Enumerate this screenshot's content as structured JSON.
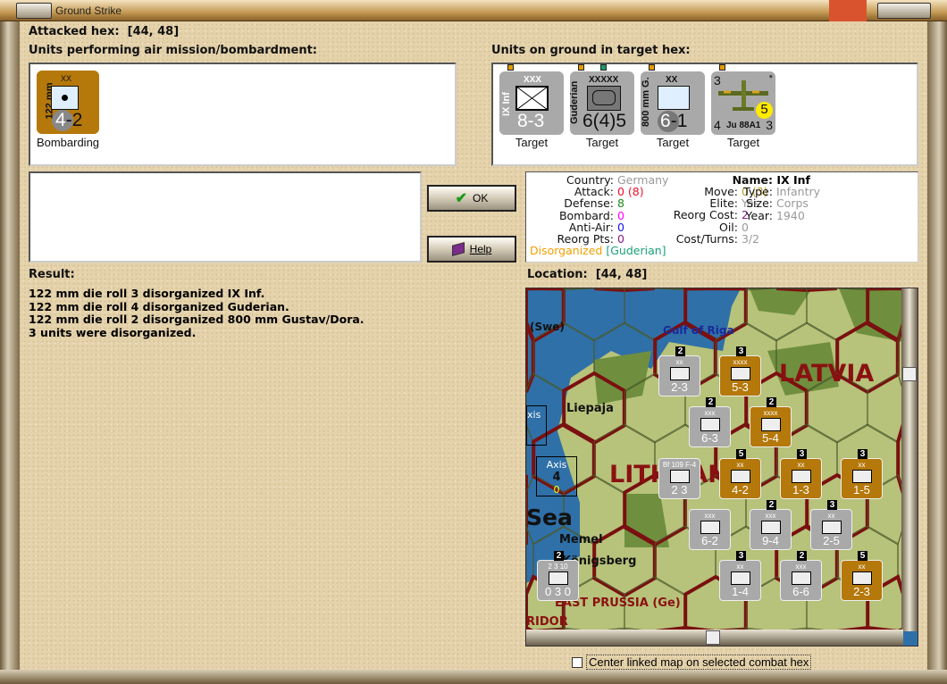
{
  "window": {
    "title": "Ground Strike"
  },
  "attacked_hex": {
    "label": "Attacked hex:",
    "value": "[44, 48]"
  },
  "air_mission": {
    "heading": "Units performing air mission/bombardment:",
    "units": [
      {
        "name": "122 mm",
        "echelon": "XX",
        "attack": "4",
        "defense": "2",
        "status": "Bombarding"
      }
    ]
  },
  "ground_units": {
    "heading": "Units on ground in target hex:",
    "units": [
      {
        "name": "IX Inf",
        "echelon": "XXX",
        "strength": "8-3",
        "status": "Target"
      },
      {
        "name": "Guderian",
        "echelon": "XXXXX",
        "strength": "6(4)5",
        "status": "Target"
      },
      {
        "name": "800 mm G.",
        "echelon": "XX",
        "attack": "6",
        "defense": "1",
        "status": "Target"
      },
      {
        "name": "Ju 88A1",
        "top_left": "3",
        "bottom_left": "4",
        "bottom_right": "3",
        "marker": "*",
        "badge": "5",
        "status": "Target"
      }
    ]
  },
  "buttons": {
    "ok": "OK",
    "help": "Help"
  },
  "unit_info": {
    "country_label": "Country:",
    "country": "Germany",
    "attack_label": "Attack:",
    "attack": "0",
    "attack_extra": "(8)",
    "defense_label": "Defense:",
    "defense": "8",
    "bombard_label": "Bombard:",
    "bombard": "0",
    "antiair_label": "Anti-Air:",
    "antiair": "0",
    "reorgpts_label": "Reorg Pts:",
    "reorgpts": "0",
    "move_label": "Move:",
    "move": "0",
    "move_extra": "(3)",
    "elite_label": "Elite:",
    "elite": "Yes",
    "reorgcost_label": "Reorg Cost:",
    "reorgcost": "2",
    "oil_label": "Oil:",
    "oil": "0",
    "costturns_label": "Cost/Turns:",
    "costturns": "3/2",
    "name_label": "Name:",
    "name": "IX Inf",
    "type_label": "Type:",
    "type": "Infantry",
    "size_label": "Size:",
    "size": "Corps",
    "year_label": "Year:",
    "year": "1940",
    "status": "Disorganized",
    "hq": "[Guderian]"
  },
  "result": {
    "heading": "Result:",
    "lines": [
      "122 mm die roll 3 disorganized IX Inf.",
      "122 mm die roll 4 disorganized Guderian.",
      "122 mm die roll 2 disorganized 800 mm Gustav/Dora.",
      "3 units were disorganized."
    ]
  },
  "location": {
    "label": "Location:",
    "value": "[44, 48]"
  },
  "map": {
    "labels": {
      "swe": "(Swe)",
      "gulf": "Gulf of Riga",
      "latvia": "LATVIA",
      "lithuania": "LITHUANIA",
      "liepaja": "Liepaja",
      "sea": "Sea",
      "memel": "Memel",
      "konigsberg": "Königsberg",
      "east_prussia": "EAST PRUSSIA (Ge)",
      "corridor": "RIDOR",
      "axis": "Axis",
      "axis_a": "4",
      "axis_b": "0",
      "axis2": "xis"
    },
    "counters": [
      {
        "color": "gray",
        "ech": "xx",
        "str": "2-3",
        "badge": "2"
      },
      {
        "color": "brown",
        "ech": "xxxx",
        "str": "5-3",
        "badge": "3"
      },
      {
        "color": "gray",
        "ech": "xxx",
        "str": "6-3",
        "badge": "2"
      },
      {
        "color": "brown",
        "ech": "xxxx",
        "str": "5-4",
        "badge": "2"
      },
      {
        "color": "gray",
        "ech": "Bf 109 F-4",
        "str": "2  3",
        "badge": ""
      },
      {
        "color": "brown",
        "ech": "xx",
        "str": "4-2",
        "badge": "5"
      },
      {
        "color": "brown",
        "ech": "xx",
        "str": "1-3",
        "badge": "3"
      },
      {
        "color": "brown",
        "ech": "xx",
        "str": "1-5",
        "badge": "3"
      },
      {
        "color": "gray",
        "ech": "xxx",
        "str": "6-2",
        "badge": ""
      },
      {
        "color": "gray",
        "ech": "xxx",
        "str": "9-4",
        "badge": "2"
      },
      {
        "color": "gray",
        "ech": "xx",
        "str": "2-5",
        "badge": "3"
      },
      {
        "color": "gray",
        "ech": "xx",
        "str": "1-4",
        "badge": "3"
      },
      {
        "color": "gray",
        "ech": "xxx",
        "str": "6-6",
        "badge": "2"
      },
      {
        "color": "brown",
        "ech": "xx",
        "str": "2-3",
        "badge": "5"
      },
      {
        "color": "gray",
        "ech": "2 3 10",
        "str": "0 3 0",
        "badge": "2"
      }
    ]
  },
  "footer": {
    "center_map_label": "Center linked map on selected combat hex",
    "center_map_checked": false
  }
}
